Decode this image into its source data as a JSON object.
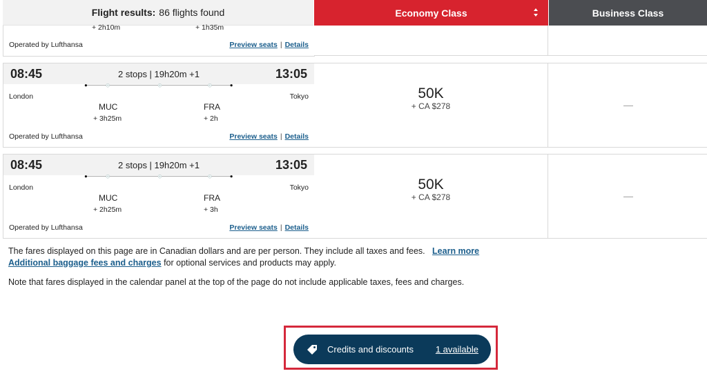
{
  "header": {
    "results_label": "Flight results:",
    "results_count": "86 flights found",
    "economy": "Economy Class",
    "business": "Business Class"
  },
  "partial": {
    "dur1": "+ 2h10m",
    "dur2": "+ 1h35m",
    "operated": "Operated by Lufthansa",
    "preview": "Preview seats",
    "sep": "|",
    "details": "Details"
  },
  "flights": [
    {
      "dep": "08:45",
      "summary": "2 stops | 19h20m +1",
      "arr": "13:05",
      "origin": "London",
      "destination": "Tokyo",
      "stop1": "MUC",
      "stop1_dur": "+ 3h25m",
      "stop2": "FRA",
      "stop2_dur": "+ 2h",
      "operated": "Operated by Lufthansa",
      "preview": "Preview seats",
      "sep": "|",
      "details": "Details",
      "econ_miles": "50K",
      "econ_tax": "+ CA $278",
      "business": "—"
    },
    {
      "dep": "08:45",
      "summary": "2 stops | 19h20m +1",
      "arr": "13:05",
      "origin": "London",
      "destination": "Tokyo",
      "stop1": "MUC",
      "stop1_dur": "+ 2h25m",
      "stop2": "FRA",
      "stop2_dur": "+ 3h",
      "operated": "Operated by Lufthansa",
      "preview": "Preview seats",
      "sep": "|",
      "details": "Details",
      "econ_miles": "50K",
      "econ_tax": "+ CA $278",
      "business": "—"
    }
  ],
  "notes": {
    "fares_text": "The fares displayed on this page are in Canadian dollars and are per person. They include all taxes and fees.",
    "learn_more": "Learn more",
    "baggage_link": "Additional baggage fees and charges",
    "baggage_text": "for optional services and products may apply.",
    "calendar_note": "Note that fares displayed in the calendar panel at the top of the page do not include applicable taxes, fees and charges."
  },
  "credits": {
    "label": "Credits and discounts",
    "available": "1 available",
    "icon": "tag-icon"
  },
  "colors": {
    "economy_header": "#d7232e",
    "business_header": "#4b4d51",
    "link": "#1b5e8c",
    "credits_button": "#0b3a5a",
    "highlight_box": "#d5283b"
  }
}
